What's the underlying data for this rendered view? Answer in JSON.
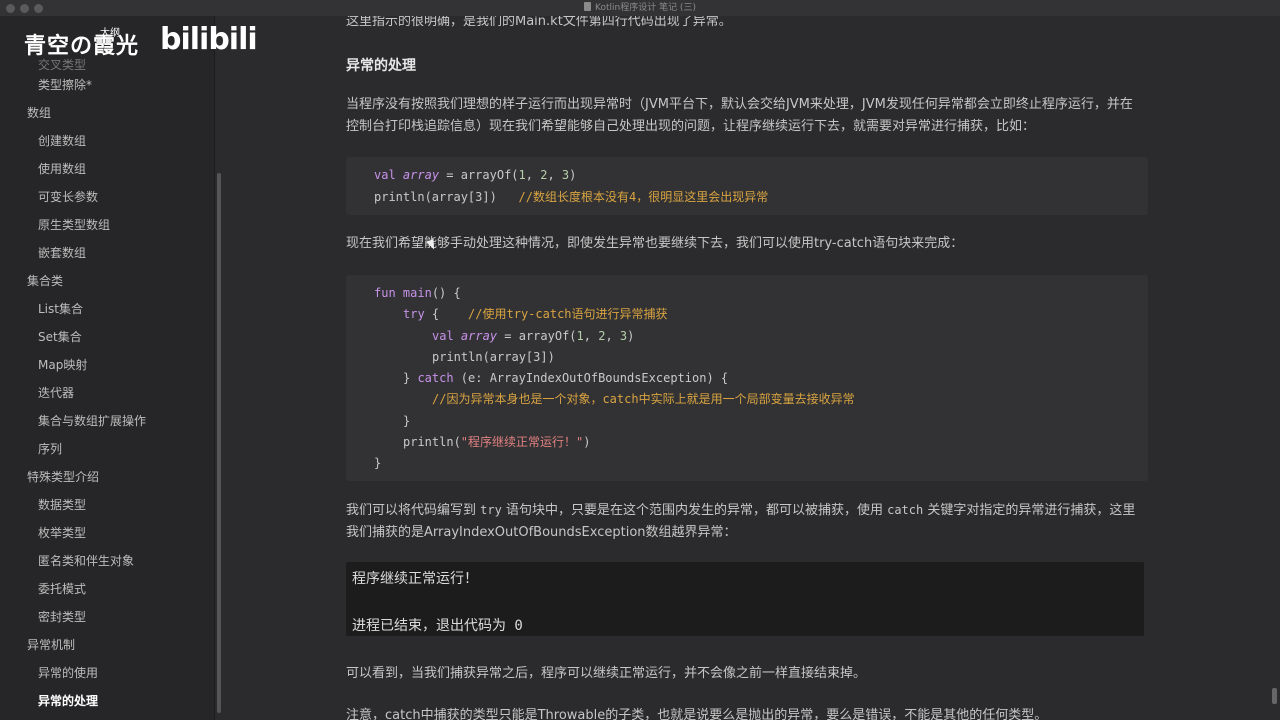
{
  "window": {
    "title": "Kotlin程序设计 笔记 (三)"
  },
  "watermark": {
    "name": "青空の霞光",
    "small": "大纲",
    "logo": "bilibili"
  },
  "sidebar": {
    "items": [
      {
        "label": "类型擦除*",
        "level": 2,
        "active": false
      },
      {
        "label": "数组",
        "level": 1,
        "active": false
      },
      {
        "label": "创建数组",
        "level": 2,
        "active": false
      },
      {
        "label": "使用数组",
        "level": 2,
        "active": false
      },
      {
        "label": "可变长参数",
        "level": 2,
        "active": false
      },
      {
        "label": "原生类型数组",
        "level": 2,
        "active": false
      },
      {
        "label": "嵌套数组",
        "level": 2,
        "active": false
      },
      {
        "label": "集合类",
        "level": 1,
        "active": false
      },
      {
        "label": "List集合",
        "level": 2,
        "active": false
      },
      {
        "label": "Set集合",
        "level": 2,
        "active": false
      },
      {
        "label": "Map映射",
        "level": 2,
        "active": false
      },
      {
        "label": "迭代器",
        "level": 2,
        "active": false
      },
      {
        "label": "集合与数组扩展操作",
        "level": 2,
        "active": false
      },
      {
        "label": "序列",
        "level": 2,
        "active": false
      },
      {
        "label": "特殊类型介绍",
        "level": 1,
        "active": false
      },
      {
        "label": "数据类型",
        "level": 2,
        "active": false
      },
      {
        "label": "枚举类型",
        "level": 2,
        "active": false
      },
      {
        "label": "匿名类和伴生对象",
        "level": 2,
        "active": false
      },
      {
        "label": "委托模式",
        "level": 2,
        "active": false
      },
      {
        "label": "密封类型",
        "level": 2,
        "active": false
      },
      {
        "label": "异常机制",
        "level": 1,
        "active": false
      },
      {
        "label": "异常的使用",
        "level": 2,
        "active": false
      },
      {
        "label": "异常的处理",
        "level": 2,
        "active": true
      }
    ]
  },
  "content": {
    "top_partial": "这里指示的很明确，是我们的Main.kt文件第四行代码出现了异常。",
    "heading": "异常的处理",
    "para1": "当程序没有按照我们理想的样子运行而出现异常时（JVM平台下，默认会交给JVM来处理，JVM发现任何异常都会立即终止程序运行，并在控制台打印栈追踪信息）现在我们希望能够自己处理出现的问题，让程序继续运行下去，就需要对异常进行捕获，比如：",
    "code1": {
      "line1": {
        "kw": "val",
        "var": "array",
        "rest1": " = arrayOf(",
        "n1": "1",
        "n2": "2",
        "n3": "3",
        "close": ")"
      },
      "line2": {
        "code": "println(array[3])",
        "comment": "//数组长度根本没有4，很明显这里会出现异常"
      }
    },
    "para2": "现在我们希望能够手动处理这种情况，即使发生异常也要继续下去，我们可以使用try-catch语句块来完成：",
    "code2": {
      "fun_kw": "fun",
      "fun_name": "main",
      "fun_rest": "() {",
      "try_kw": "try",
      "try_rest": " {",
      "try_comment": "//使用try-catch语句进行异常捕获",
      "val_kw": "val",
      "val_var": "array",
      "val_rest": " = arrayOf(",
      "n1": "1",
      "n2": "2",
      "n3": "3",
      "val_close": ")",
      "print1": "println(array[3])",
      "catch_open": "} ",
      "catch_kw": "catch",
      "catch_rest": " (e: ArrayIndexOutOfBoundsException) {",
      "catch_comment": "//因为异常本身也是一个对象，catch中实际上就是用一个局部变量去接收异常",
      "close_inner": "}",
      "print2_a": "println(",
      "print2_str": "\"程序继续正常运行！\"",
      "print2_b": ")",
      "close_outer": "}"
    },
    "para3a": "我们可以将代码编写到 ",
    "para3_try": "try",
    "para3b": " 语句块中，只要是在这个范围内发生的异常，都可以被捕获，使用 ",
    "para3_catch": "catch",
    "para3c": " 关键字对指定的异常进行捕获，这里我们捕获的是ArrayIndexOutOfBoundsException数组越界异常：",
    "terminal": {
      "line1": "程序继续正常运行！",
      "line2": "进程已结束，退出代码为 0"
    },
    "para4": "可以看到，当我们捕获异常之后，程序可以继续正常运行，并不会像之前一样直接结束掉。",
    "para5_partial": "注意，catch中捕获的类型只能是Throwable的子类，也就是说要么是抛出的异常，要么是错误，不能是其他的任何类型。"
  }
}
